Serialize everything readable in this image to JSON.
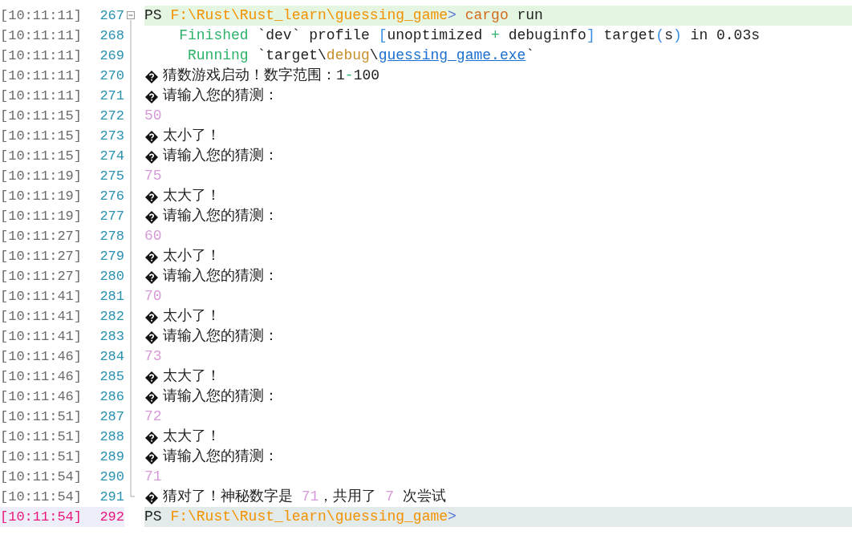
{
  "lines": [
    {
      "time": "[10:11:11]",
      "number": "267",
      "kind": "command",
      "fold_start": true,
      "segments": [
        {
          "text": "PS ",
          "kind": "plain"
        },
        {
          "text": "F:\\Rust\\Rust_learn\\guessing_game",
          "kind": "path"
        },
        {
          "text": ">",
          "kind": "prompt"
        },
        {
          "text": " cargo",
          "kind": "command"
        },
        {
          "text": " run",
          "kind": "plain"
        }
      ]
    },
    {
      "time": "[10:11:11]",
      "number": "268",
      "kind": "cargo-status",
      "segments": [
        {
          "text": "Finished",
          "kind": "green"
        },
        {
          "text": " `dev` profile ",
          "kind": "plain"
        },
        {
          "text": "[",
          "kind": "bracket"
        },
        {
          "text": "unoptimized ",
          "kind": "plain"
        },
        {
          "text": "+",
          "kind": "green"
        },
        {
          "text": " debuginfo",
          "kind": "plain"
        },
        {
          "text": "]",
          "kind": "bracket"
        },
        {
          "text": " target",
          "kind": "plain"
        },
        {
          "text": "(",
          "kind": "bracket"
        },
        {
          "text": "s",
          "kind": "plain"
        },
        {
          "text": ")",
          "kind": "bracket"
        },
        {
          "text": " in 0.03s",
          "kind": "plain"
        }
      ]
    },
    {
      "time": "[10:11:11]",
      "number": "269",
      "kind": "cargo-status",
      "segments": [
        {
          "text": "Running",
          "kind": "green"
        },
        {
          "text": " `target\\",
          "kind": "plain"
        },
        {
          "text": "debug",
          "kind": "brown"
        },
        {
          "text": "\\",
          "kind": "plain"
        },
        {
          "text": "guessing_game.exe",
          "kind": "link"
        },
        {
          "text": "`",
          "kind": "plain"
        }
      ]
    },
    {
      "time": "[10:11:11]",
      "number": "270",
      "kind": "message",
      "segments": [
        {
          "text": "猜数游戏启动！数字范围：1",
          "kind": "plain"
        },
        {
          "text": "-",
          "kind": "green"
        },
        {
          "text": "100",
          "kind": "plain"
        }
      ]
    },
    {
      "time": "[10:11:11]",
      "number": "271",
      "kind": "message",
      "segments": [
        {
          "text": "请输入您的猜测：",
          "kind": "plain"
        }
      ]
    },
    {
      "time": "[10:11:15]",
      "number": "272",
      "kind": "input",
      "segments": [
        {
          "text": "50",
          "kind": "number"
        }
      ]
    },
    {
      "time": "[10:11:15]",
      "number": "273",
      "kind": "message",
      "segments": [
        {
          "text": "太小了！",
          "kind": "plain"
        }
      ]
    },
    {
      "time": "[10:11:15]",
      "number": "274",
      "kind": "message",
      "segments": [
        {
          "text": "请输入您的猜测：",
          "kind": "plain"
        }
      ]
    },
    {
      "time": "[10:11:19]",
      "number": "275",
      "kind": "input",
      "segments": [
        {
          "text": "75",
          "kind": "number"
        }
      ]
    },
    {
      "time": "[10:11:19]",
      "number": "276",
      "kind": "message",
      "segments": [
        {
          "text": "太大了！",
          "kind": "plain"
        }
      ]
    },
    {
      "time": "[10:11:19]",
      "number": "277",
      "kind": "message",
      "segments": [
        {
          "text": "请输入您的猜测：",
          "kind": "plain"
        }
      ]
    },
    {
      "time": "[10:11:27]",
      "number": "278",
      "kind": "input",
      "segments": [
        {
          "text": "60",
          "kind": "number"
        }
      ]
    },
    {
      "time": "[10:11:27]",
      "number": "279",
      "kind": "message",
      "segments": [
        {
          "text": "太小了！",
          "kind": "plain"
        }
      ]
    },
    {
      "time": "[10:11:27]",
      "number": "280",
      "kind": "message",
      "segments": [
        {
          "text": "请输入您的猜测：",
          "kind": "plain"
        }
      ]
    },
    {
      "time": "[10:11:41]",
      "number": "281",
      "kind": "input",
      "segments": [
        {
          "text": "70",
          "kind": "number"
        }
      ]
    },
    {
      "time": "[10:11:41]",
      "number": "282",
      "kind": "message",
      "segments": [
        {
          "text": "太小了！",
          "kind": "plain"
        }
      ]
    },
    {
      "time": "[10:11:41]",
      "number": "283",
      "kind": "message",
      "segments": [
        {
          "text": "请输入您的猜测：",
          "kind": "plain"
        }
      ]
    },
    {
      "time": "[10:11:46]",
      "number": "284",
      "kind": "input",
      "segments": [
        {
          "text": "73",
          "kind": "number"
        }
      ]
    },
    {
      "time": "[10:11:46]",
      "number": "285",
      "kind": "message",
      "segments": [
        {
          "text": "太大了！",
          "kind": "plain"
        }
      ]
    },
    {
      "time": "[10:11:46]",
      "number": "286",
      "kind": "message",
      "segments": [
        {
          "text": "请输入您的猜测：",
          "kind": "plain"
        }
      ]
    },
    {
      "time": "[10:11:51]",
      "number": "287",
      "kind": "input",
      "segments": [
        {
          "text": "72",
          "kind": "number"
        }
      ]
    },
    {
      "time": "[10:11:51]",
      "number": "288",
      "kind": "message",
      "segments": [
        {
          "text": "太大了！",
          "kind": "plain"
        }
      ]
    },
    {
      "time": "[10:11:51]",
      "number": "289",
      "kind": "message",
      "segments": [
        {
          "text": "请输入您的猜测：",
          "kind": "plain"
        }
      ]
    },
    {
      "time": "[10:11:54]",
      "number": "290",
      "kind": "input",
      "segments": [
        {
          "text": "71",
          "kind": "number"
        }
      ]
    },
    {
      "time": "[10:11:54]",
      "number": "291",
      "kind": "message",
      "fold_end": true,
      "segments": [
        {
          "text": "猜对了！神秘数字是 ",
          "kind": "plain"
        },
        {
          "text": "71",
          "kind": "number"
        },
        {
          "text": "，共用了 ",
          "kind": "plain"
        },
        {
          "text": "7",
          "kind": "number"
        },
        {
          "text": " 次尝试",
          "kind": "plain"
        }
      ]
    },
    {
      "time": "[10:11:54]",
      "number": "292",
      "kind": "command",
      "current": true,
      "segments": [
        {
          "text": "PS ",
          "kind": "plain"
        },
        {
          "text": "F:\\Rust\\Rust_learn\\guessing_game",
          "kind": "path"
        },
        {
          "text": ">",
          "kind": "prompt"
        }
      ]
    }
  ]
}
